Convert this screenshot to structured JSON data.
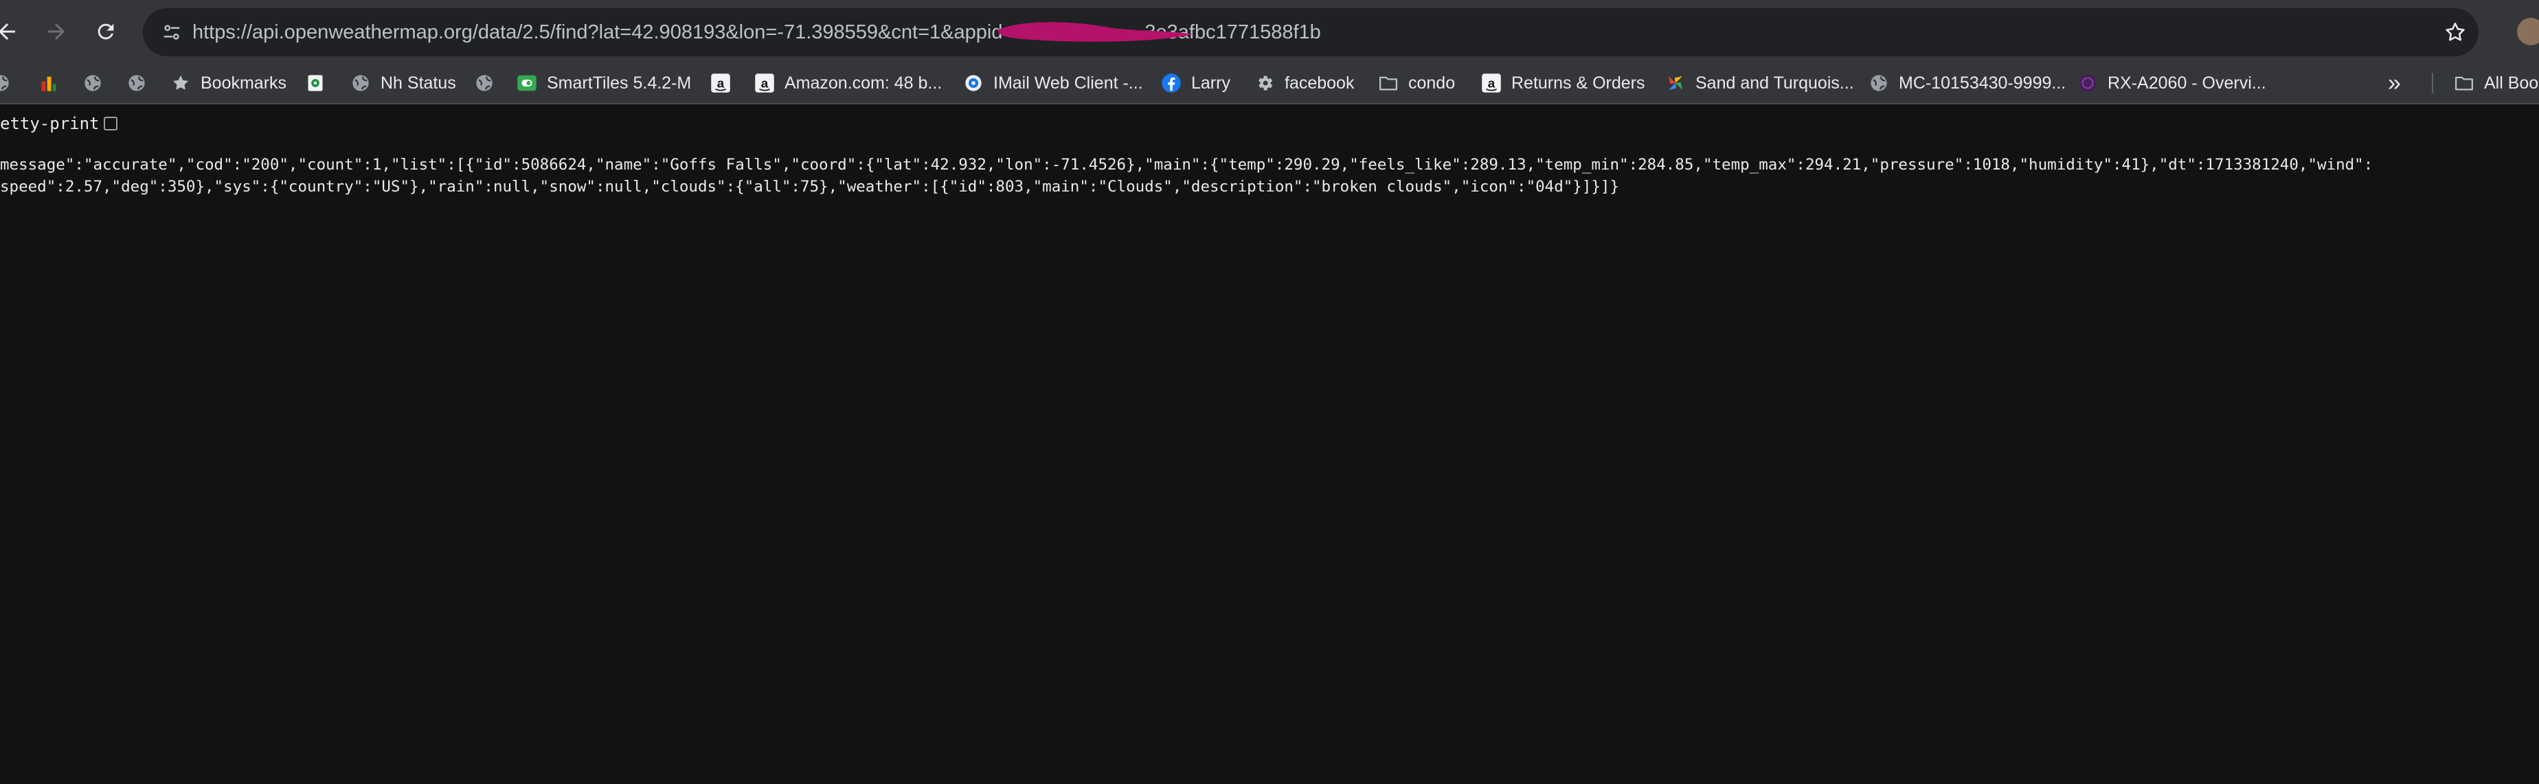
{
  "browser": {
    "url_before_redaction": "https://api.openweathermap.org/data/2.5/find?lat=42.908193&lon=-71.398559&cnt=1&appid=",
    "url_after_redaction": "3e3afbc1771588f1b",
    "redaction_color": "#b5126a"
  },
  "bookmarks": [
    {
      "label": "",
      "icon": "globe-icon"
    },
    {
      "label": "",
      "icon": "bar-chart-icon"
    },
    {
      "label": "",
      "icon": "globe-icon"
    },
    {
      "label": "",
      "icon": "globe-icon"
    },
    {
      "label": "Bookmarks",
      "icon": "star-icon"
    },
    {
      "label": "",
      "icon": "camera-icon"
    },
    {
      "label": "Nh Status",
      "icon": "globe-icon"
    },
    {
      "label": "",
      "icon": "globe-icon"
    },
    {
      "label": "SmartTiles 5.4.2-M",
      "icon": "smarttiles-icon"
    },
    {
      "label": "",
      "icon": "amazon-icon"
    },
    {
      "label": "Amazon.com: 48 b...",
      "icon": "amazon-icon"
    },
    {
      "label": "IMail Web Client -...",
      "icon": "imail-icon"
    },
    {
      "label": "Larry",
      "icon": "facebook-icon"
    },
    {
      "label": "facebook",
      "icon": "gear-icon"
    },
    {
      "label": "condo",
      "icon": "folder-icon"
    },
    {
      "label": "Returns & Orders",
      "icon": "amazon-icon"
    },
    {
      "label": "Sand and Turquois...",
      "icon": "pinwheel-icon"
    },
    {
      "label": "MC-10153430-9999...",
      "icon": "globe-icon"
    },
    {
      "label": "RX-A2060 - Overvi...",
      "icon": "yamaha-icon"
    }
  ],
  "overflow_label": "»",
  "all_bookmarks_label": "All Boo",
  "pretty_print": {
    "label": "etty-print",
    "checked": false
  },
  "json_lines": [
    "message\":\"accurate\",\"cod\":\"200\",\"count\":1,\"list\":[{\"id\":5086624,\"name\":\"Goffs Falls\",\"coord\":{\"lat\":42.932,\"lon\":-71.4526},\"main\":{\"temp\":290.29,\"feels_like\":289.13,\"temp_min\":284.85,\"temp_max\":294.21,\"pressure\":1018,\"humidity\":41},\"dt\":1713381240,\"wind\":",
    "speed\":2.57,\"deg\":350},\"sys\":{\"country\":\"US\"},\"rain\":null,\"snow\":null,\"clouds\":{\"all\":75},\"weather\":[{\"id\":803,\"main\":\"Clouds\",\"description\":\"broken clouds\",\"icon\":\"04d\"}]}]}"
  ]
}
